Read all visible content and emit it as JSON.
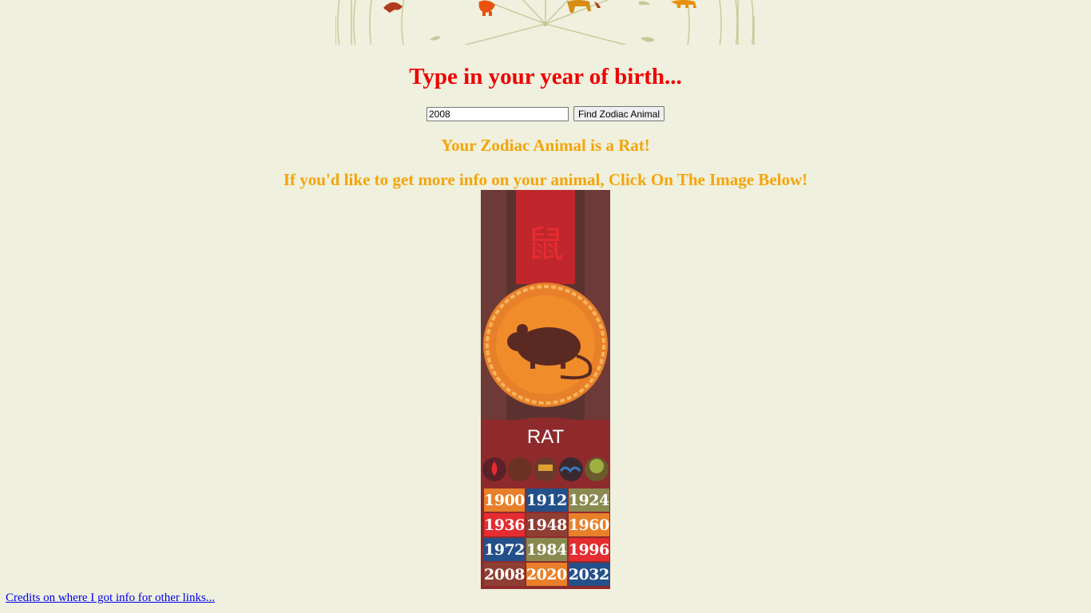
{
  "heading": {
    "text": "Type in your year of birth..."
  },
  "form": {
    "year_value": "2008",
    "button_label": "Find Zodiac Animal"
  },
  "result": {
    "text": "Your Zodiac Animal is a Rat!",
    "info": "If you'd like to get more info on your animal, Click On The Image Below!"
  },
  "card": {
    "glyph": "鼠",
    "label": "RAT",
    "years": [
      {
        "year": "1900",
        "color": "#e8802a"
      },
      {
        "year": "1912",
        "color": "#24508a"
      },
      {
        "year": "1924",
        "color": "#8a8a50"
      },
      {
        "year": "1936",
        "color": "#e52c30"
      },
      {
        "year": "1948",
        "color": "#8f3e33"
      },
      {
        "year": "1960",
        "color": "#e8802a"
      },
      {
        "year": "1972",
        "color": "#24508a"
      },
      {
        "year": "1984",
        "color": "#8a8a50"
      },
      {
        "year": "1996",
        "color": "#e52c30"
      },
      {
        "year": "2008",
        "color": "#8f3e33"
      },
      {
        "year": "2020",
        "color": "#e8802a"
      },
      {
        "year": "2032",
        "color": "#24508a"
      }
    ],
    "element_icons": [
      "fire-icon",
      "earth-icon",
      "metal-icon",
      "water-icon",
      "wood-icon"
    ]
  },
  "footer": {
    "credits": "Credits on where I got info for other links..."
  }
}
